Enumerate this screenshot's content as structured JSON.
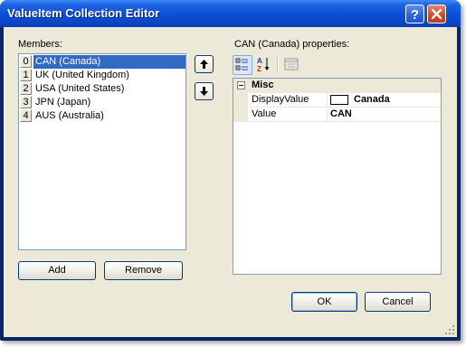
{
  "window": {
    "title": "ValueItem Collection Editor",
    "help_label": "?",
    "close_label": "close"
  },
  "members": {
    "label": "Members:",
    "items": [
      {
        "index": "0",
        "text": "CAN (Canada)",
        "selected": true
      },
      {
        "index": "1",
        "text": "UK (United Kingdom)",
        "selected": false
      },
      {
        "index": "2",
        "text": "USA (United States)",
        "selected": false
      },
      {
        "index": "3",
        "text": "JPN (Japan)",
        "selected": false
      },
      {
        "index": "4",
        "text": "AUS (Australia)",
        "selected": false
      }
    ],
    "move_up_icon": "arrow-up-icon",
    "move_down_icon": "arrow-down-icon",
    "add_label": "Add",
    "remove_label": "Remove"
  },
  "properties": {
    "label": "CAN (Canada) properties:",
    "toolbar": {
      "categorized_icon": "categorized-icon",
      "alphabetical_icon": "alphabetical-az-icon",
      "property_pages_icon": "property-pages-icon"
    },
    "category": {
      "name": "Misc",
      "expanded": true
    },
    "rows": [
      {
        "name": "DisplayValue",
        "value": "Canada",
        "swatch_color": "#ffffff"
      },
      {
        "name": "Value",
        "value": "CAN"
      }
    ]
  },
  "footer": {
    "ok_label": "OK",
    "cancel_label": "Cancel"
  },
  "colors": {
    "title_bar": "#0b4fd6",
    "selection": "#316ac5",
    "dialog_face": "#ece9d8",
    "button_border": "#003c74"
  }
}
